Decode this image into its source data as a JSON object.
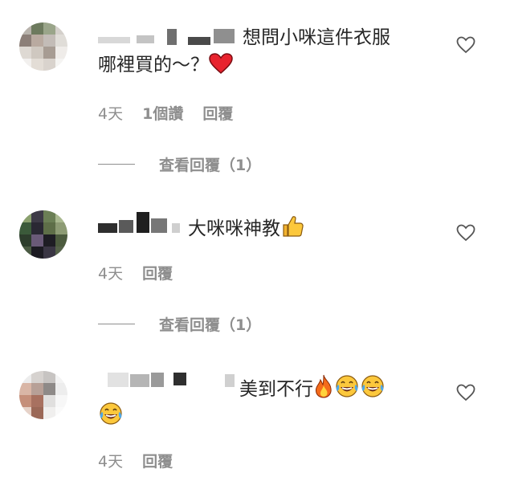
{
  "comments": [
    {
      "text_line1": "想問小咪這件衣服",
      "text_line2": "哪裡買的～？",
      "time": "4天",
      "likes": "1個讚",
      "reply": "回覆",
      "view_replies": "查看回覆（1）"
    },
    {
      "text_line1": "大咪咪神教",
      "time": "4天",
      "reply": "回覆",
      "view_replies": "查看回覆（1）"
    },
    {
      "text_line1": "美到不行",
      "time": "4天",
      "reply": "回覆"
    }
  ],
  "icons": {
    "like": "heart-outline-icon",
    "red_heart": "red-heart-emoji",
    "thumbs_up": "thumbs-up-emoji",
    "fire": "fire-emoji",
    "laugh": "tears-of-joy-emoji"
  },
  "colors": {
    "text": "#262626",
    "secondary": "#8e8e8e",
    "heart": "#ed4956"
  }
}
